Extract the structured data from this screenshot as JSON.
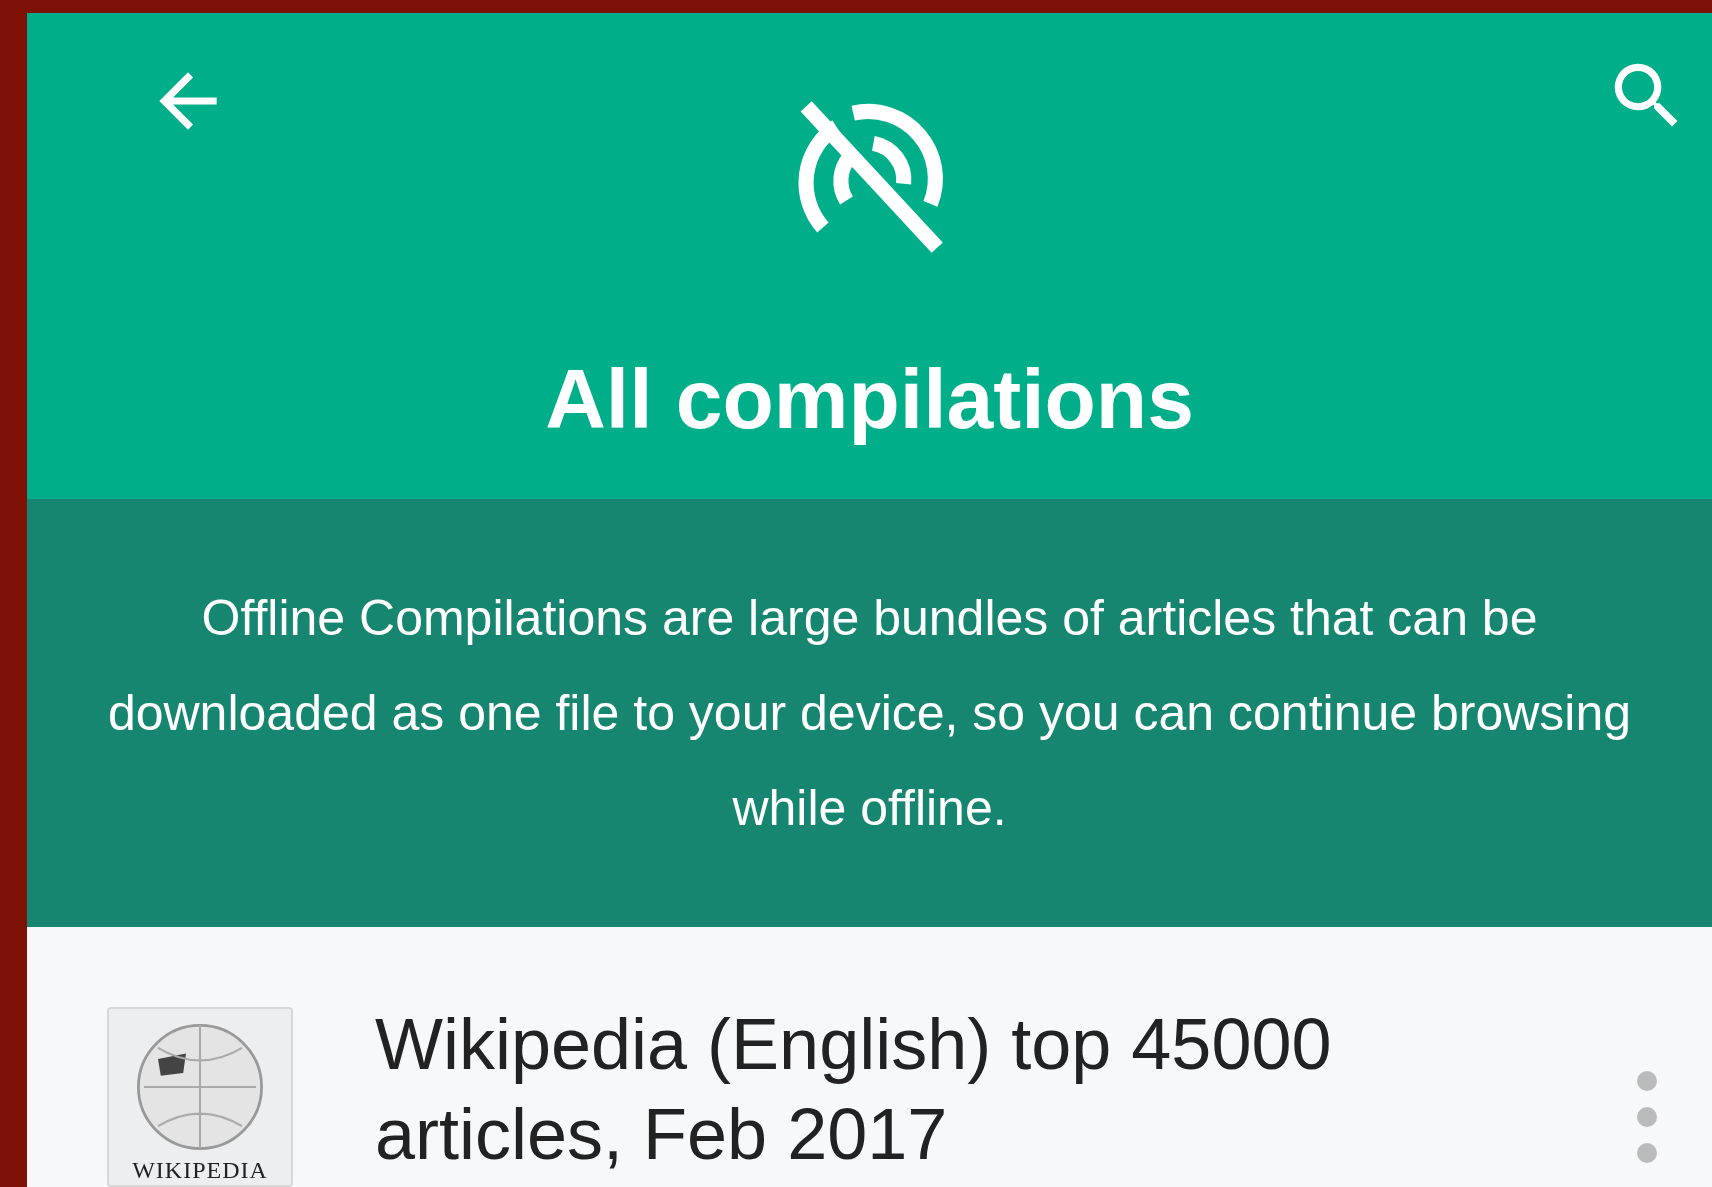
{
  "header": {
    "title": "All compilations"
  },
  "banner": {
    "text": "Offline Compilations are large bundles of articles that can be downloaded as one file to your device, so you can continue browsing while offline."
  },
  "compilations": [
    {
      "title": "Wikipedia (English) top 45000 articles, Feb 2017",
      "logo_text": "WIKIPEDIA"
    }
  ]
}
